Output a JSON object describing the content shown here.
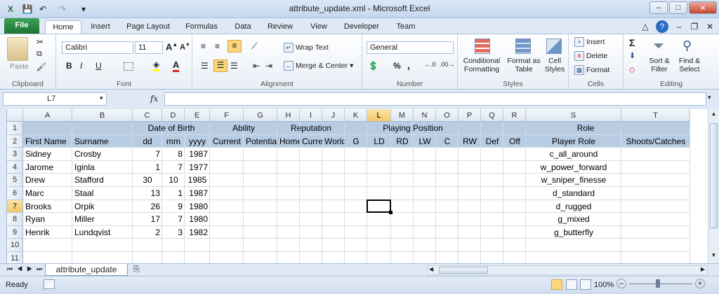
{
  "window": {
    "title": "attribute_update.xml  -  Microsoft Excel",
    "minimize": "–",
    "maximize": "□",
    "close": "✕"
  },
  "tabs": [
    "File",
    "Home",
    "Insert",
    "Page Layout",
    "Formulas",
    "Data",
    "Review",
    "View",
    "Developer",
    "Team"
  ],
  "ribbon": {
    "clipboard": {
      "label": "Clipboard",
      "paste": "Paste"
    },
    "font": {
      "label": "Font",
      "name": "Calibri",
      "size": "11",
      "bold": "B",
      "italic": "I",
      "underline": "U"
    },
    "alignment": {
      "label": "Alignment",
      "wrap": "Wrap Text",
      "merge": "Merge & Center"
    },
    "number": {
      "label": "Number",
      "format": "General",
      "percent": "%",
      "comma": ","
    },
    "styles": {
      "label": "Styles",
      "conditional": "Conditional Formatting",
      "format_table": "Format as Table",
      "cell_styles": "Cell Styles"
    },
    "cells": {
      "label": "Cells",
      "insert": "Insert",
      "delete": "Delete",
      "format": "Format"
    },
    "editing": {
      "label": "Editing",
      "sort": "Sort & Filter",
      "find": "Find & Select",
      "sigma": "Σ"
    }
  },
  "formula_bar": {
    "name_box": "L7",
    "fx": "fx",
    "value": ""
  },
  "columns": [
    "A",
    "B",
    "C",
    "D",
    "E",
    "F",
    "G",
    "H",
    "I",
    "J",
    "K",
    "L",
    "M",
    "N",
    "O",
    "P",
    "Q",
    "R",
    "S",
    "T"
  ],
  "selected_column": "L",
  "selected_row": "7",
  "rows": [
    "1",
    "2",
    "3",
    "4",
    "5",
    "6",
    "7",
    "8",
    "9",
    "10",
    "11"
  ],
  "header_row1": {
    "date_of_birth": "Date of Birth",
    "ability": "Ability",
    "reputation": "Reputation",
    "playing_position": "Playing Position",
    "role": "Role"
  },
  "header_row2": [
    "First Name",
    "Surname",
    "dd",
    "mm",
    "yyyy",
    "Current",
    "Potential",
    "Home",
    "Current",
    "World",
    "G",
    "LD",
    "RD",
    "LW",
    "C",
    "RW",
    "Def",
    "Off",
    "Player Role",
    "Shoots/Catches"
  ],
  "players": [
    {
      "first": "Sidney",
      "last": "Crosby",
      "dd": "7",
      "mm": "8",
      "yyyy": "1987",
      "role": "c_all_around"
    },
    {
      "first": "Jarome",
      "last": "Iginla",
      "dd": "1",
      "mm": "7",
      "yyyy": "1977",
      "role": "w_power_forward"
    },
    {
      "first": "Drew",
      "last": "Stafford",
      "dd": "30",
      "mm": "10",
      "yyyy": "1985",
      "role": "w_sniper_finesse"
    },
    {
      "first": "Marc",
      "last": "Staal",
      "dd": "13",
      "mm": "1",
      "yyyy": "1987",
      "role": "d_standard"
    },
    {
      "first": "Brooks",
      "last": "Orpik",
      "dd": "26",
      "mm": "9",
      "yyyy": "1980",
      "role": "d_rugged"
    },
    {
      "first": "Ryan",
      "last": "Miller",
      "dd": "17",
      "mm": "7",
      "yyyy": "1980",
      "role": "g_mixed"
    },
    {
      "first": "Henrik",
      "last": "Lundqvist",
      "dd": "2",
      "mm": "3",
      "yyyy": "1982",
      "role": "g_butterfly"
    }
  ],
  "sheet_tab": "attribute_update",
  "status": {
    "ready": "Ready",
    "zoom": "100%"
  }
}
